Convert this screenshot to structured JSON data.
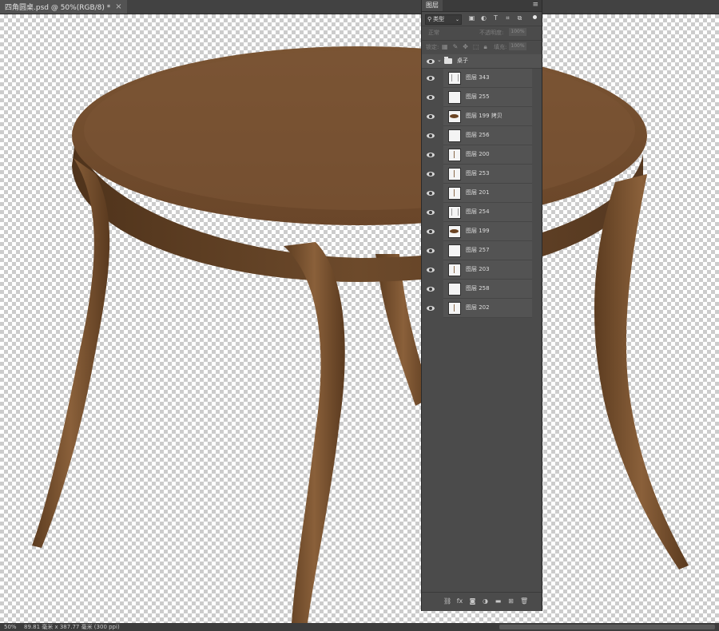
{
  "document_tab": {
    "title": "四角圆桌.psd @ 50%(RGB/8) *",
    "close_symbol": "×"
  },
  "status": {
    "zoom": "50%",
    "info": "89.81 毫米 x 387.77 毫米 (300 ppi)"
  },
  "layers_panel": {
    "tab_label": "图层",
    "menu_symbol": "≡",
    "filter": {
      "icon": "search-icon",
      "value": "类型"
    },
    "filter_icons": [
      "image-icon",
      "adjustment-icon",
      "type-icon",
      "transform-icon",
      "smart-object-icon"
    ],
    "blend_mode": "正常",
    "opacity_label": "不透明度:",
    "opacity_value": "100%",
    "lock_label": "锁定:",
    "fill_label": "填充:",
    "fill_value": "100%",
    "group": {
      "name": "桌子",
      "visible": true
    },
    "layers": [
      {
        "name": "图层 343",
        "thumb": "sketch"
      },
      {
        "name": "图层 255",
        "thumb": "blank"
      },
      {
        "name": "图层 199 拷贝",
        "thumb": "ellipse"
      },
      {
        "name": "图层 256",
        "thumb": "blank"
      },
      {
        "name": "图层 200",
        "thumb": "leg"
      },
      {
        "name": "图层 253",
        "thumb": "leg"
      },
      {
        "name": "图层 201",
        "thumb": "leg"
      },
      {
        "name": "图层 254",
        "thumb": "sketch"
      },
      {
        "name": "图层 199",
        "thumb": "ellipse"
      },
      {
        "name": "图层 257",
        "thumb": "blank"
      },
      {
        "name": "图层 203",
        "thumb": "leg"
      },
      {
        "name": "图层 258",
        "thumb": "blank"
      },
      {
        "name": "图层 202",
        "thumb": "leg"
      }
    ],
    "footer_icons": [
      "link-icon",
      "fx-icon",
      "mask-icon",
      "adjustment-layer-icon",
      "folder-icon",
      "new-layer-icon",
      "trash-icon"
    ]
  },
  "colors": {
    "canvas_wood": "#6e4a2b",
    "panel_bg": "#4b4b4b",
    "layer_row": "#535353"
  }
}
